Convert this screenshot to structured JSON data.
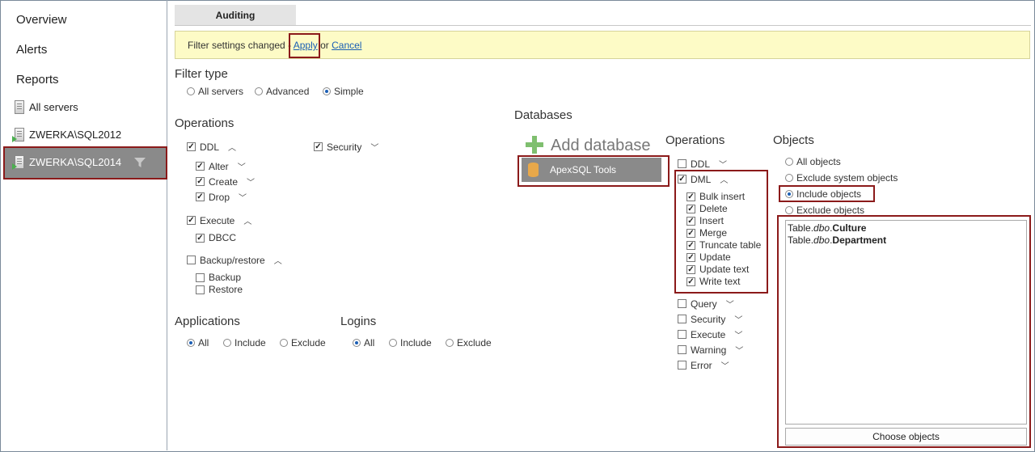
{
  "sidebar": {
    "nav": [
      "Overview",
      "Alerts",
      "Reports"
    ],
    "servers": [
      "All servers",
      "ZWERKA\\SQL2012",
      "ZWERKA\\SQL2014"
    ]
  },
  "tab": {
    "label": "Auditing"
  },
  "banner": {
    "text": "Filter settings changed - ",
    "apply": "Apply",
    "or": " or ",
    "cancel": "Cancel"
  },
  "filter_type": {
    "title": "Filter type",
    "options": [
      "All servers",
      "Advanced",
      "Simple"
    ],
    "selected": "Simple"
  },
  "operations": {
    "title": "Operations",
    "ddl": "DDL",
    "alter": "Alter",
    "create": "Create",
    "drop": "Drop",
    "execute": "Execute",
    "dbcc": "DBCC",
    "backup_restore": "Backup/restore",
    "backup": "Backup",
    "restore": "Restore",
    "security": "Security"
  },
  "applications": {
    "title": "Applications",
    "options": [
      "All",
      "Include",
      "Exclude"
    ],
    "selected": "All"
  },
  "logins": {
    "title": "Logins",
    "options": [
      "All",
      "Include",
      "Exclude"
    ],
    "selected": "All"
  },
  "databases": {
    "title": "Databases",
    "add": "Add database",
    "items": [
      "ApexSQL Tools"
    ]
  },
  "db_operations": {
    "title": "Operations",
    "ddl": "DDL",
    "dml": "DML",
    "dml_items": [
      "Bulk insert",
      "Delete",
      "Insert",
      "Merge",
      "Truncate table",
      "Update",
      "Update text",
      "Write text"
    ],
    "others": [
      "Query",
      "Security",
      "Execute",
      "Warning",
      "Error"
    ]
  },
  "objects": {
    "title": "Objects",
    "options": [
      "All objects",
      "Exclude system objects",
      "Include objects",
      "Exclude objects"
    ],
    "selected": "Include objects",
    "list": [
      {
        "prefix": "Table.",
        "schema": "dbo",
        "dot": ".",
        "name": "Culture"
      },
      {
        "prefix": "Table.",
        "schema": "dbo",
        "dot": ".",
        "name": "Department"
      }
    ],
    "choose": "Choose objects"
  },
  "colors": {
    "highlight": "#8b1a1a",
    "banner_bg": "#fdfbc6",
    "link": "#1a5fb4",
    "selected_bg": "#8a8a8a"
  }
}
